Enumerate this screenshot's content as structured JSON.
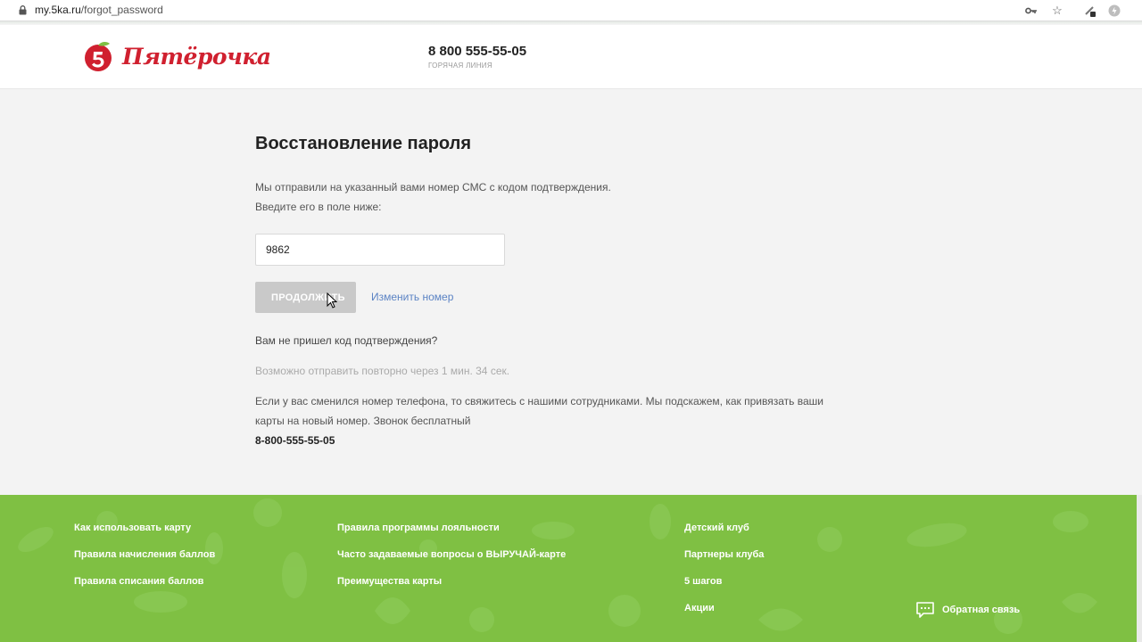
{
  "browser": {
    "url_host": "my.5ka.ru",
    "url_path": "/forgot_password"
  },
  "header": {
    "logo_text": "Пятёрочка",
    "phone": "8 800 555-55-05",
    "phone_caption": "горячая линия"
  },
  "main": {
    "title": "Восстановление пароля",
    "sent_text": "Мы отправили на указанный вами номер СМС с кодом подтверждения.",
    "enter_text": "Введите его в поле ниже:",
    "code_value": "9862",
    "continue_label": "Продолжить",
    "change_number_label": "Изменить номер",
    "no_code_question": "Вам не пришел код подтверждения?",
    "resend_timer": "Возможно отправить повторно через 1 мин. 34 сек.",
    "info_line1": "Если у вас сменился номер телефона, то свяжитесь с нашими сотрудниками. Мы подскажем, как привязать ваши",
    "info_line2": "карты на новый номер. Звонок бесплатный",
    "hotline": "8-800-555-55-05"
  },
  "footer": {
    "col1": [
      "Как использовать карту",
      "Правила начисления баллов",
      "Правила списания баллов"
    ],
    "col2": [
      "Правила программы лояльности",
      "Часто задаваемые вопросы о ВЫРУЧАЙ-карте",
      "Преимущества карты"
    ],
    "col3": [
      "Детский клуб",
      "Партнеры клуба",
      "5 шагов",
      "Акции"
    ],
    "feedback_label": "Обратная связь"
  },
  "colors": {
    "brand_red": "#d0202f",
    "footer_green": "#7fc043",
    "link_blue": "#5b83c4",
    "button_disabled": "#c9c9c9"
  },
  "icons": [
    "lock-icon",
    "key-icon",
    "star-icon",
    "extension-icon",
    "profile-icon",
    "cursor-icon",
    "chat-icon"
  ]
}
